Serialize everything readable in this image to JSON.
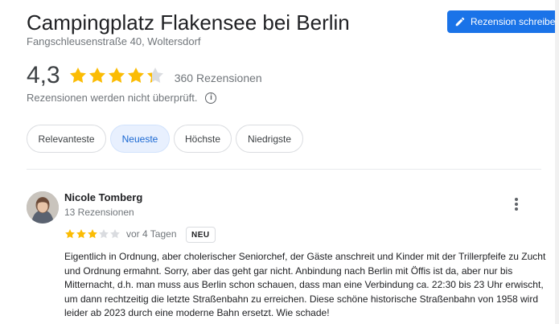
{
  "place": {
    "title": "Campingplatz Flakensee bei Berlin",
    "address": "Fangschleusenstraße 40, Woltersdorf",
    "rating": "4,3",
    "rating_value": 4.3,
    "review_count": "360 Rezensionen",
    "not_verified": "Rezensionen werden nicht überprüft."
  },
  "write_review": {
    "label": "Rezension schreiben",
    "icon": "pencil-icon"
  },
  "sort_chips": [
    {
      "label": "Relevanteste",
      "active": false
    },
    {
      "label": "Neueste",
      "active": true
    },
    {
      "label": "Höchste",
      "active": false
    },
    {
      "label": "Niedrigste",
      "active": false
    }
  ],
  "review": {
    "name": "Nicole Tomberg",
    "meta": "13 Rezensionen",
    "stars": 3,
    "date": "vor 4 Tagen",
    "badge": "NEU",
    "text": "Eigentlich in Ordnung, aber cholerischer Seniorchef, der Gäste anschreit und Kinder mit der Trillerpfeife zu Zucht und Ordnung ermahnt.  Sorry, aber das geht gar nicht. Anbindung nach Berlin mit Öffis ist da, aber nur bis Mitternacht, d.h. man muss aus Berlin schon schauen, dass man eine Verbindung ca. 22:30 bis 23 Uhr erwischt, um dann rechtzeitig die letzte Straßenbahn zu erreichen. Diese schöne historische Straßenbahn von 1958 wird leider ab 2023 durch eine moderne Bahn ersetzt. Wie schade!"
  },
  "colors": {
    "star": "#fbbc04",
    "star_empty": "#dadce0",
    "accent": "#1a73e8",
    "chip_active_bg": "#e8f0fe"
  }
}
